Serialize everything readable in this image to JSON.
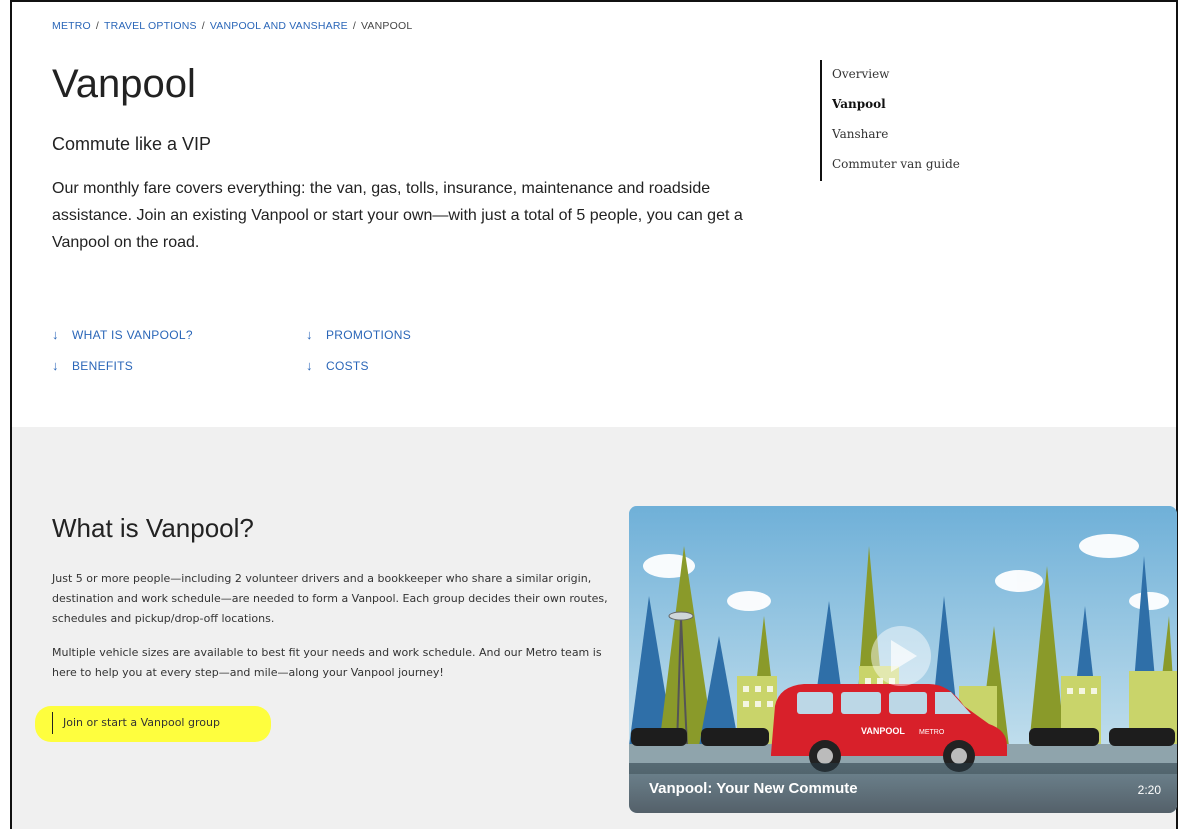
{
  "breadcrumb": {
    "items": [
      "METRO",
      "TRAVEL OPTIONS",
      "VANPOOL AND VANSHARE"
    ],
    "separator": "/",
    "current": "VANPOOL"
  },
  "page": {
    "title": "Vanpool",
    "subtitle": "Commute like a VIP",
    "intro": "Our monthly fare covers everything: the van, gas, tolls, insurance, maintenance and roadside assistance. Join an existing Vanpool or start your own—with just a total of 5 people, you can get a Vanpool on the road."
  },
  "side_nav": {
    "items": [
      {
        "label": "Overview",
        "active": false
      },
      {
        "label": "Vanpool",
        "active": true
      },
      {
        "label": "Vanshare",
        "active": false
      },
      {
        "label": "Commuter van guide",
        "active": false
      }
    ]
  },
  "jump_links": {
    "arrow": "↓",
    "items": [
      "WHAT IS VANPOOL?",
      "BENEFITS",
      "PROMOTIONS",
      "COSTS"
    ]
  },
  "section": {
    "heading": "What is Vanpool?",
    "para1": "Just 5 or more people—including 2 volunteer drivers and a bookkeeper who share a similar origin, destination and work schedule—are needed to form a Vanpool. Each group decides their own routes, schedules and pickup/drop-off locations.",
    "para2": "Multiple vehicle sizes are available to best fit your needs and work schedule. And our Metro team is here to help you at every step—and mile—along your Vanpool journey!",
    "link": "Join or start a Vanpool group",
    "highlight_color": "#ffff2a"
  },
  "video": {
    "title": "Vanpool: Your New Commute",
    "duration": "2:20",
    "van_text": "VANPOOL",
    "van_brand": "METRO",
    "play_icon": "play-icon",
    "colors": {
      "sky": "#9ec7e0",
      "van": "#d8202a",
      "tree_blue": "#2f6fa8",
      "tree_green": "#8a9a2a"
    }
  },
  "colors": {
    "link": "#2a66b8",
    "section_bg": "#f0f0f0"
  }
}
